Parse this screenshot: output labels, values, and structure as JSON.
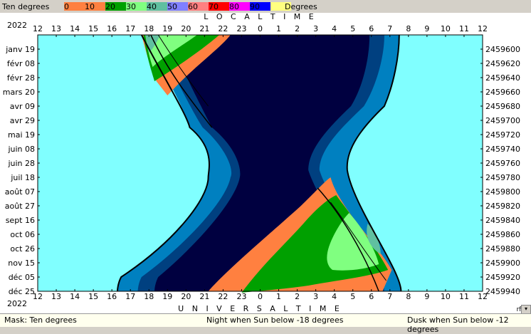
{
  "legend": {
    "left_label": "Ten degrees",
    "right_label": "Degrees",
    "levels": [
      {
        "label": "0",
        "color": "#ff8040"
      },
      {
        "label": "10",
        "color": "#ff8040"
      },
      {
        "label": "20",
        "color": "#00a000"
      },
      {
        "label": "30",
        "color": "#80ff80"
      },
      {
        "label": "40",
        "color": "#60c0a0"
      },
      {
        "label": "50",
        "color": "#8080ff"
      },
      {
        "label": "60",
        "color": "#ff8080"
      },
      {
        "label": "70",
        "color": "#ff0000"
      },
      {
        "label": "80",
        "color": "#ff00ff"
      },
      {
        "label": "90",
        "color": "#0000ff"
      },
      {
        "label": "",
        "color": "#ffff80"
      }
    ]
  },
  "chart_data": {
    "type": "area",
    "title_top": "L O C A L   T I M E",
    "title_bottom": "U N I V E R S A L   T I M E",
    "year_top": "2022",
    "year_bottom": "2022",
    "hour_ticks": [
      "12",
      "13",
      "14",
      "15",
      "16",
      "17",
      "18",
      "19",
      "20",
      "21",
      "22",
      "23",
      "0",
      "1",
      "2",
      "3",
      "4",
      "5",
      "6",
      "7",
      "8",
      "9",
      "10",
      "11",
      "12"
    ],
    "date_labels": [
      "janv 19",
      "févr 08",
      "févr 28",
      "mars 20",
      "avr 09",
      "avr 29",
      "mai 19",
      "juin 08",
      "juin 28",
      "juil 18",
      "août 07",
      "août 27",
      "sept 16",
      "oct 06",
      "oct 26",
      "nov 15",
      "déc 05",
      "déc 25"
    ],
    "jd_labels": [
      "2459600",
      "2459620",
      "2459640",
      "2459660",
      "2459680",
      "2459700",
      "2459720",
      "2459740",
      "2459760",
      "2459780",
      "2459800",
      "2459820",
      "2459840",
      "2459860",
      "2459880",
      "2459900",
      "2459920",
      "2459940"
    ],
    "corner_label": "rf",
    "colors": {
      "day": "#80ffff",
      "civil": "#0080c0",
      "nautical": "#004080",
      "night": "#000040",
      "alt10": "#ff8040",
      "alt20": "#00a000",
      "alt30": "#80ff80",
      "alt40": "#60c0a0"
    }
  },
  "status": {
    "mask": "Mask:  Ten degrees",
    "night": "Night when Sun below -18 degrees",
    "dusk": "Dusk when Sun below -12 degrees"
  }
}
